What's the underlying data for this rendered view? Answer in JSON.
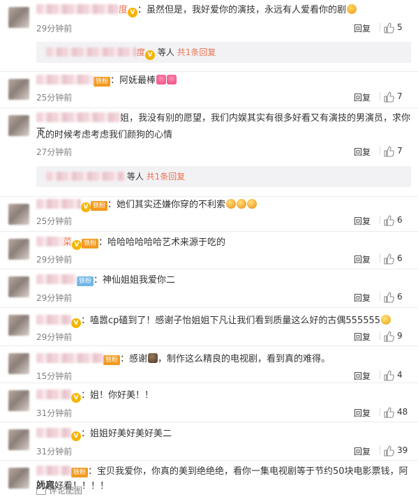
{
  "comments": [
    {
      "name_tail": "度",
      "text": "：虽然但是，我好爱你的演技，永远有人爱看你的剧",
      "time": "29分钟前",
      "reply": "回复",
      "likes": "5",
      "reply_summary": {
        "who": "等人",
        "count_text": "共1条回复"
      }
    },
    {
      "badge": "铁粉",
      "text": "：阿妩最棒",
      "time": "25分钟前",
      "reply": "回复",
      "likes": "7"
    },
    {
      "name_tail": "姐",
      "text_l1": "，我没有别的愿望，我们内娱其实有很多好看又有演技的男演员，求你下",
      "text_l2": "凡的时候考虑考虑我们颜狗的心情",
      "time": "27分钟前",
      "reply": "回复",
      "likes": "7",
      "reply_summary": {
        "who": "等人",
        "count_text": "共1条回复"
      }
    },
    {
      "badge": "铁粉",
      "text": "：她们其实还嫌你穿的不利索",
      "time": "25分钟前",
      "reply": "回复",
      "likes": "6"
    },
    {
      "name_tail": "菜",
      "badge": "铁粉",
      "text": "：哈哈哈哈哈哈艺术来源于吃的",
      "time": "29分钟前",
      "reply": "回复",
      "likes": "6"
    },
    {
      "badge": "铁粉",
      "text": "：神仙姐姐我爱你二",
      "time": "29分钟前",
      "reply": "回复",
      "likes": "6"
    },
    {
      "text": "：嗑嚣cp磕到了！感谢子怡姐姐下凡让我们看到质量这么好的古偶555555",
      "time": "29分钟前",
      "reply": "回复",
      "likes": "9"
    },
    {
      "badge": "铁粉",
      "text": "：感谢",
      "text_after": "，制作这么精良的电视剧，看到真的难得。",
      "time": "15分钟前",
      "reply": "回复",
      "likes": "4"
    },
    {
      "text": "：姐！你好美！！",
      "time": "31分钟前",
      "reply": "回复",
      "likes": "48"
    },
    {
      "text": "：姐姐好美好美好美二",
      "time": "31分钟前",
      "reply": "回复",
      "likes": "39"
    },
    {
      "badge": "铁粉",
      "text_l1": "：宝贝我爱你，你真的美到绝绝绝，看你一集电视剧等于节约50块电影票钱，阿妩真",
      "text_l2": "的超好看！！！！"
    }
  ],
  "footer": {
    "label": "评论配图"
  },
  "icons": {
    "like": "thumbs-up-icon",
    "vip": "vip-crown-icon",
    "footer": "image-icon"
  },
  "colors": {
    "accent": "#eb7350",
    "fan_gold": "#f39a1f",
    "fan_blue": "#6fb6e8"
  }
}
